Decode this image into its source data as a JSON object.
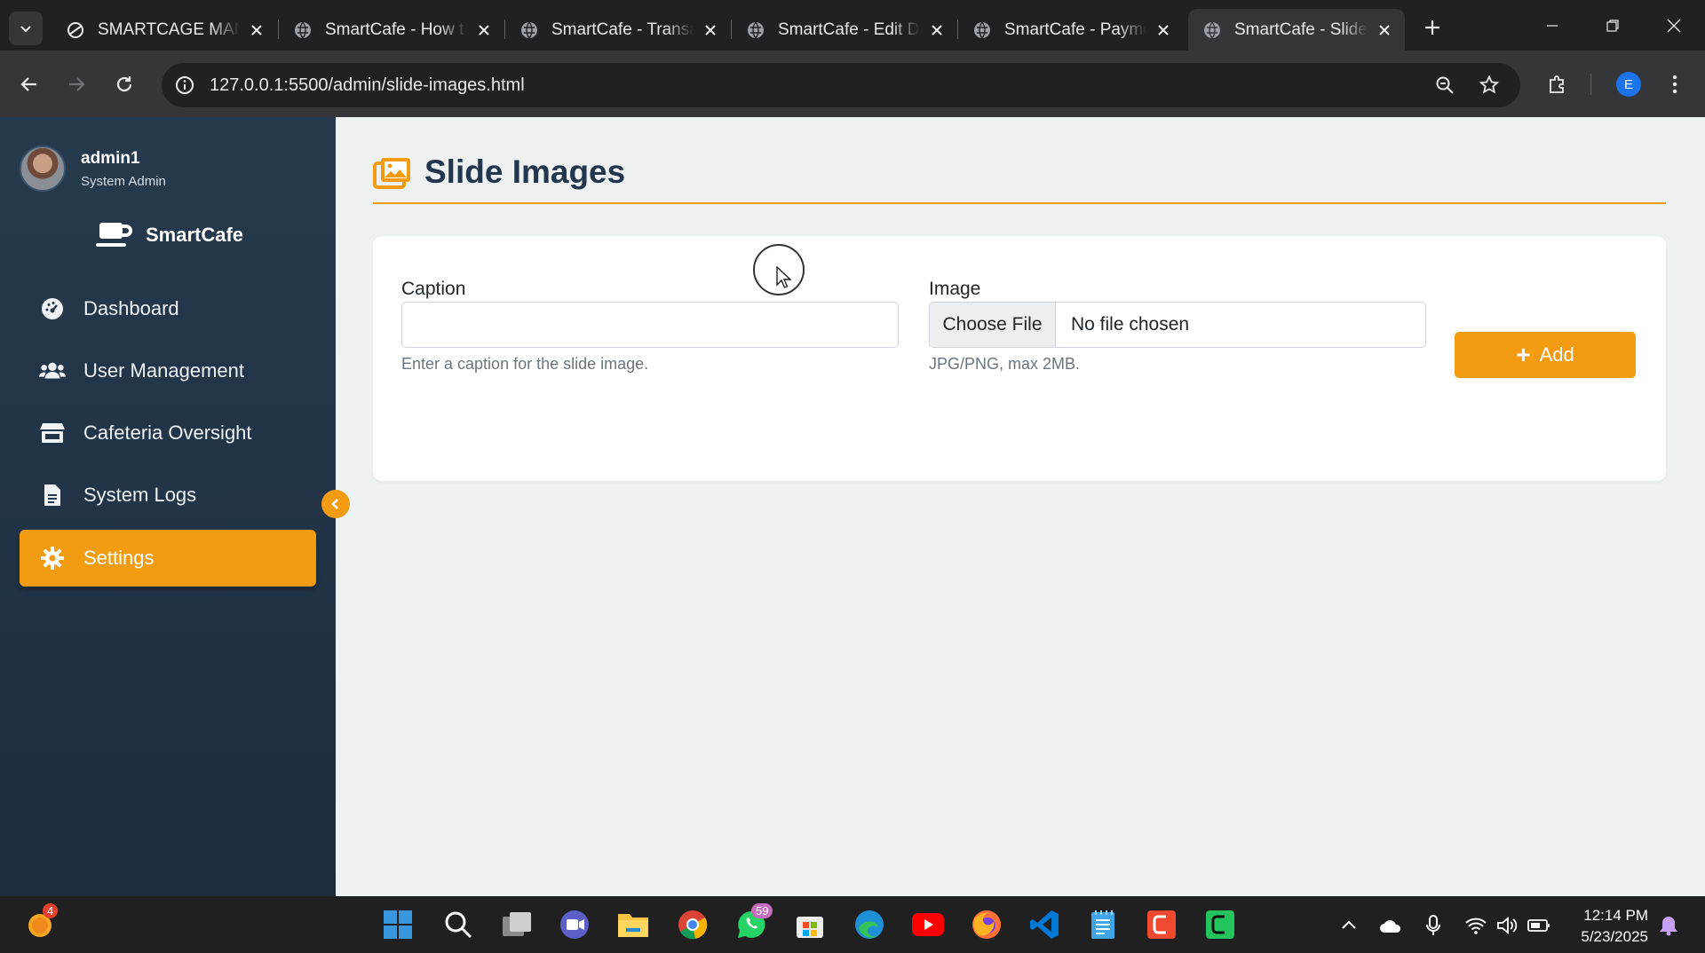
{
  "browser": {
    "tabs": [
      {
        "title": "SMARTCAGE MAN",
        "active": false
      },
      {
        "title": "SmartCafe - How t",
        "active": false
      },
      {
        "title": "SmartCafe - Transa",
        "active": false
      },
      {
        "title": "SmartCafe - Edit D",
        "active": false
      },
      {
        "title": "SmartCafe - Payme",
        "active": false
      },
      {
        "title": "SmartCafe - Slide I",
        "active": true
      }
    ],
    "url": "127.0.0.1:5500/admin/slide-images.html",
    "profile_initial": "E"
  },
  "sidebar": {
    "user": {
      "name": "admin1",
      "role": "System Admin"
    },
    "brand": "SmartCafe",
    "items": [
      {
        "label": "Dashboard",
        "icon": "dashboard-icon",
        "active": false
      },
      {
        "label": "User Management",
        "icon": "users-icon",
        "active": false
      },
      {
        "label": "Cafeteria Oversight",
        "icon": "store-icon",
        "active": false
      },
      {
        "label": "System Logs",
        "icon": "file-icon",
        "active": false
      },
      {
        "label": "Settings",
        "icon": "gear-icon",
        "active": true
      }
    ]
  },
  "page": {
    "title": "Slide Images",
    "form": {
      "caption_label": "Caption",
      "caption_value": "",
      "caption_hint": "Enter a caption for the slide image.",
      "image_label": "Image",
      "choose_file_label": "Choose File",
      "file_status": "No file chosen",
      "image_hint": "JPG/PNG, max 2MB.",
      "add_label": "Add"
    }
  },
  "taskbar": {
    "notification_badge": "4",
    "whatsapp_badge": "59",
    "time": "12:14 PM",
    "date": "5/23/2025"
  },
  "colors": {
    "accent": "#f39c12",
    "sidebar": "#22344a",
    "title": "#22374d"
  }
}
